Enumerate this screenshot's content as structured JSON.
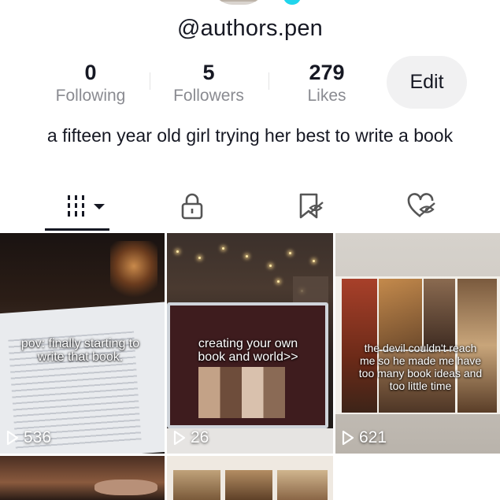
{
  "profile": {
    "username": "@authors.pen",
    "bio": "a fifteen year old girl trying her best to write a book",
    "edit_label": "Edit"
  },
  "stats": [
    {
      "value": "0",
      "label": "Following"
    },
    {
      "value": "5",
      "label": "Followers"
    },
    {
      "value": "279",
      "label": "Likes"
    }
  ],
  "tabs": [
    {
      "name": "videos",
      "icon": "grid-bars-icon",
      "active": true
    },
    {
      "name": "private",
      "icon": "lock-icon",
      "active": false
    },
    {
      "name": "favorites",
      "icon": "bookmark-hidden-icon",
      "active": false
    },
    {
      "name": "liked",
      "icon": "heart-hidden-icon",
      "active": false
    }
  ],
  "videos": [
    {
      "caption": "pov: finally starting to write that book.",
      "views": "536"
    },
    {
      "caption": "creating your own book and world>>",
      "views": "26"
    },
    {
      "caption": "the devil couldn't reach me so he made me have too many book ideas and too little time",
      "views": "621"
    },
    {
      "caption": "",
      "views": ""
    },
    {
      "caption": "",
      "views": ""
    }
  ],
  "colors": {
    "text": "#161823",
    "muted": "#8a8b91",
    "button_bg": "#f1f1f2",
    "badge": "#20d5ec"
  }
}
